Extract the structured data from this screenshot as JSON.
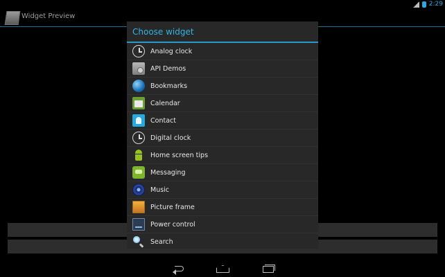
{
  "status_bar": {
    "time": "2:29"
  },
  "app": {
    "title": "Widget Preview"
  },
  "dialog": {
    "title": "Choose widget",
    "items": [
      {
        "label": "Analog clock",
        "icon": "analog-clock-icon"
      },
      {
        "label": "API Demos",
        "icon": "api-demos-icon"
      },
      {
        "label": "Bookmarks",
        "icon": "bookmarks-globe-icon"
      },
      {
        "label": "Calendar",
        "icon": "calendar-icon"
      },
      {
        "label": "Contact",
        "icon": "contact-icon"
      },
      {
        "label": "Digital clock",
        "icon": "digital-clock-icon"
      },
      {
        "label": "Home screen tips",
        "icon": "android-icon"
      },
      {
        "label": "Messaging",
        "icon": "messaging-icon"
      },
      {
        "label": "Music",
        "icon": "music-icon"
      },
      {
        "label": "Picture frame",
        "icon": "picture-frame-icon"
      },
      {
        "label": "Power control",
        "icon": "power-control-icon"
      },
      {
        "label": "Search",
        "icon": "search-icon"
      }
    ]
  },
  "colors": {
    "accent": "#34b3e4",
    "dialog_bg": "#282828"
  }
}
